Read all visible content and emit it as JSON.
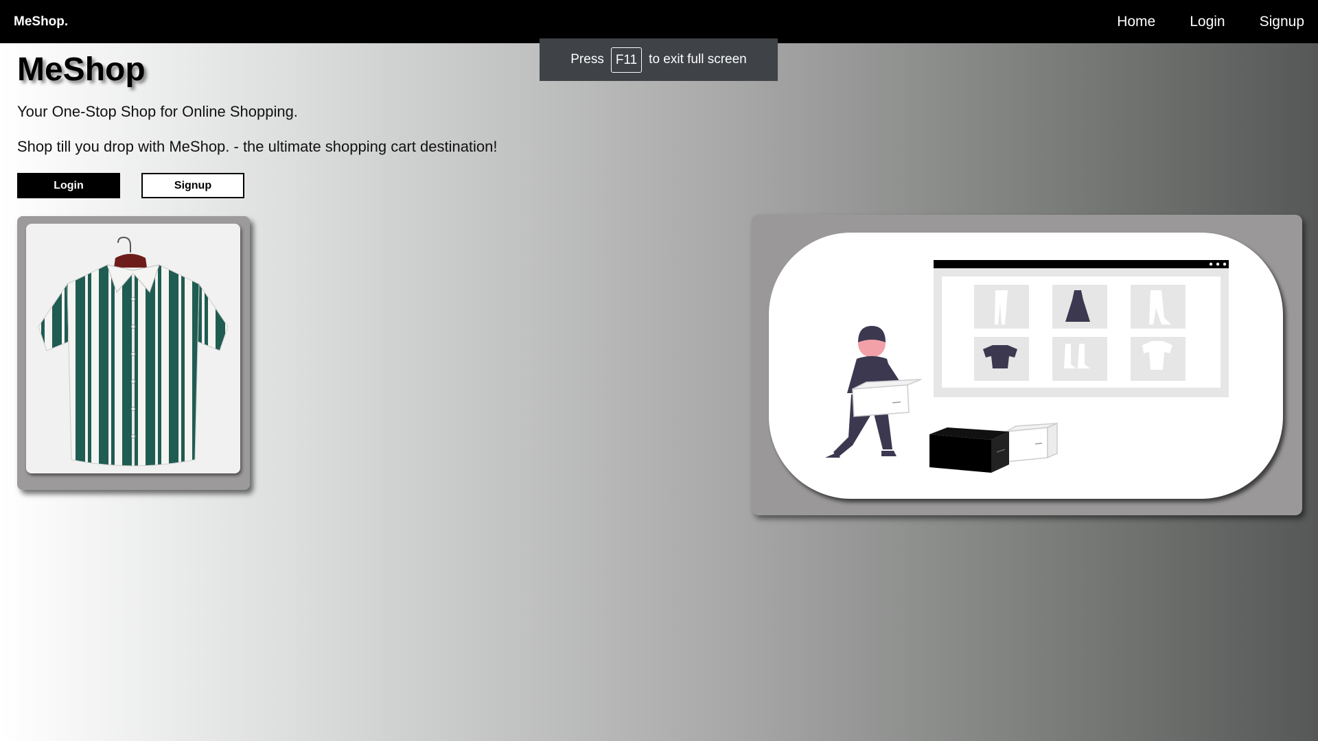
{
  "navbar": {
    "brand": "MeShop.",
    "links": [
      {
        "label": "Home"
      },
      {
        "label": "Login"
      },
      {
        "label": "Signup"
      }
    ]
  },
  "toast": {
    "press": "Press",
    "key": "F11",
    "suffix": "to exit full screen"
  },
  "hero": {
    "title": "MeShop",
    "tagline1": "Your One-Stop Shop for Online Shopping.",
    "tagline2": "Shop till you drop with MeShop. - the ultimate shopping cart destination!",
    "login_label": "Login",
    "signup_label": "Signup"
  },
  "colors": {
    "navbar_bg": "#000000",
    "shirt_green": "#1f5c52",
    "toast_bg": "#3f4247",
    "illus_dark": "#3b3850",
    "accent_pink": "#f3a1a8"
  },
  "icons": {
    "product": "striped-shirt-image",
    "illustration": "online-shopping-illustration"
  }
}
